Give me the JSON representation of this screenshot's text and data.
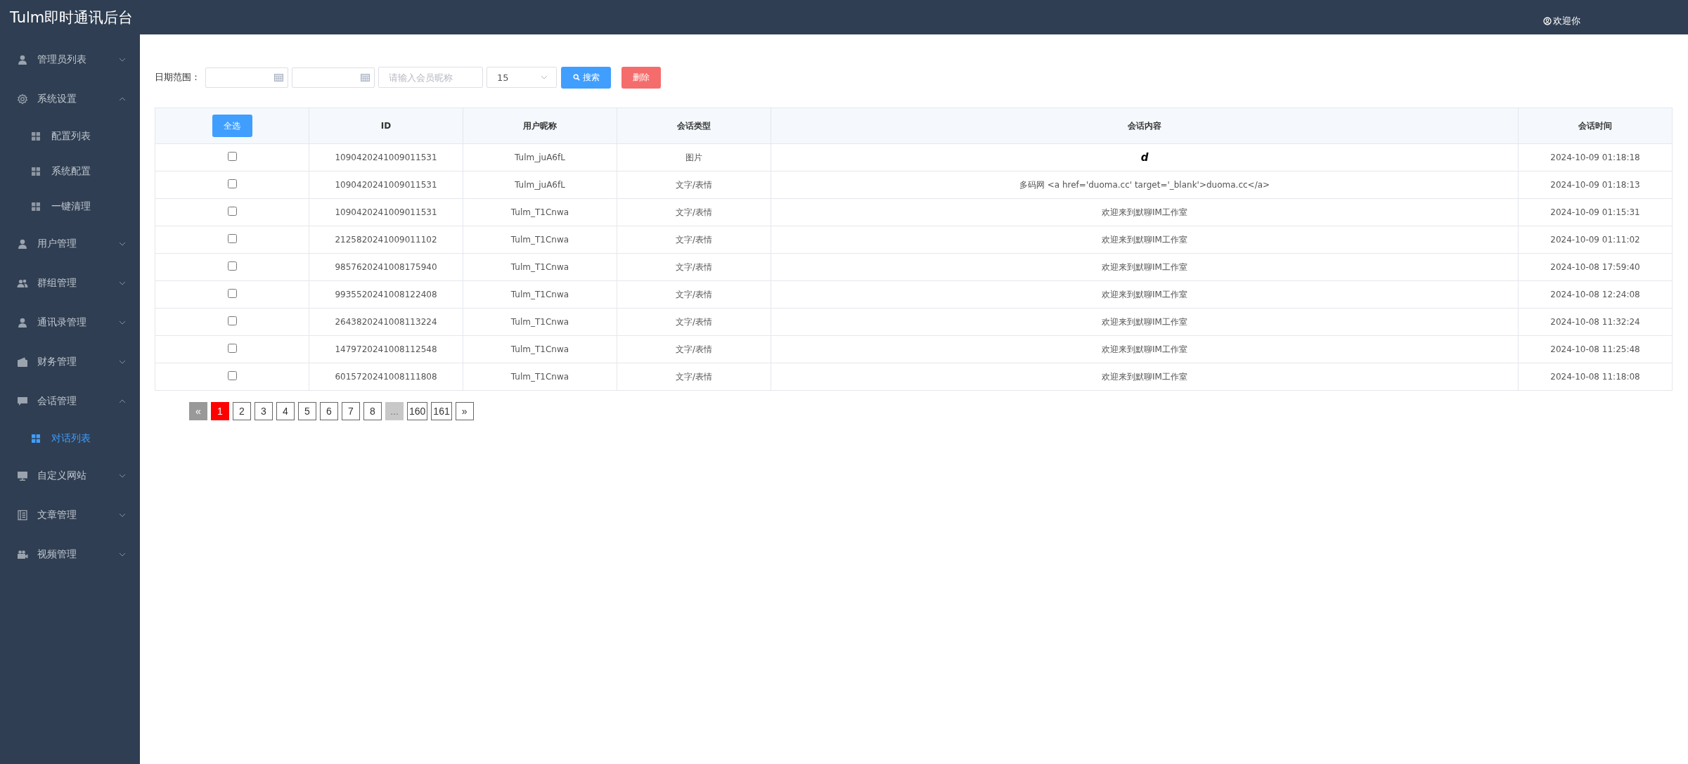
{
  "header": {
    "title": "Tulm即时通讯后台",
    "user": "欢迎你"
  },
  "sidebar": {
    "items": [
      {
        "label": "管理员列表",
        "kind": "user",
        "expanded": false
      },
      {
        "label": "系统设置",
        "kind": "gear",
        "expanded": true,
        "children": [
          {
            "label": "配置列表",
            "selected": false
          },
          {
            "label": "系统配置",
            "selected": false
          },
          {
            "label": "一键清理",
            "selected": false
          }
        ]
      },
      {
        "label": "用户管理",
        "kind": "user",
        "expanded": false
      },
      {
        "label": "群组管理",
        "kind": "group",
        "expanded": false
      },
      {
        "label": "通讯录管理",
        "kind": "user",
        "expanded": false
      },
      {
        "label": "财务管理",
        "kind": "wallet",
        "expanded": false
      },
      {
        "label": "会话管理",
        "kind": "chat",
        "expanded": true,
        "children": [
          {
            "label": "对话列表",
            "selected": true
          }
        ]
      },
      {
        "label": "自定义网站",
        "kind": "monitor",
        "expanded": false
      },
      {
        "label": "文章管理",
        "kind": "book",
        "expanded": false
      },
      {
        "label": "视频管理",
        "kind": "camera",
        "expanded": false
      }
    ]
  },
  "toolbar": {
    "date_label": "日期范围：",
    "nickname_placeholder": "请输入会员昵称",
    "page_size": "15",
    "search_button": "搜索",
    "delete_button": "删除"
  },
  "table": {
    "select_all": "全选",
    "columns": [
      "ID",
      "用户昵称",
      "会话类型",
      "会话内容",
      "会话时间"
    ],
    "rows": [
      {
        "checked": false,
        "id": "1090420241009011531",
        "nickname": "Tulm_juA6fL",
        "type": "图片",
        "content": "d",
        "kind": "image",
        "time": "2024-10-09 01:18:18"
      },
      {
        "checked": false,
        "id": "1090420241009011531",
        "nickname": "Tulm_juA6fL",
        "type": "文字/表情",
        "content": "多码网 <a href='duoma.cc' target='_blank'>duoma.cc</a>",
        "kind": "text",
        "time": "2024-10-09 01:18:13"
      },
      {
        "checked": false,
        "id": "1090420241009011531",
        "nickname": "Tulm_T1Cnwa",
        "type": "文字/表情",
        "content": "欢迎来到默聊IM工作室",
        "kind": "text",
        "time": "2024-10-09 01:15:31"
      },
      {
        "checked": false,
        "id": "2125820241009011102",
        "nickname": "Tulm_T1Cnwa",
        "type": "文字/表情",
        "content": "欢迎来到默聊IM工作室",
        "kind": "text",
        "time": "2024-10-09 01:11:02"
      },
      {
        "checked": false,
        "id": "9857620241008175940",
        "nickname": "Tulm_T1Cnwa",
        "type": "文字/表情",
        "content": "欢迎来到默聊IM工作室",
        "kind": "text",
        "time": "2024-10-08 17:59:40"
      },
      {
        "checked": false,
        "id": "9935520241008122408",
        "nickname": "Tulm_T1Cnwa",
        "type": "文字/表情",
        "content": "欢迎来到默聊IM工作室",
        "kind": "text",
        "time": "2024-10-08 12:24:08"
      },
      {
        "checked": false,
        "id": "2643820241008113224",
        "nickname": "Tulm_T1Cnwa",
        "type": "文字/表情",
        "content": "欢迎来到默聊IM工作室",
        "kind": "text",
        "time": "2024-10-08 11:32:24"
      },
      {
        "checked": false,
        "id": "1479720241008112548",
        "nickname": "Tulm_T1Cnwa",
        "type": "文字/表情",
        "content": "欢迎来到默聊IM工作室",
        "kind": "text",
        "time": "2024-10-08 11:25:48"
      },
      {
        "checked": false,
        "id": "6015720241008111808",
        "nickname": "Tulm_T1Cnwa",
        "type": "文字/表情",
        "content": "欢迎来到默聊IM工作室",
        "kind": "text",
        "time": "2024-10-08 11:18:08"
      }
    ]
  },
  "pagination": [
    {
      "label": "«",
      "kind": "prev",
      "selected": false,
      "disabled": true
    },
    {
      "label": "1",
      "kind": "page",
      "selected": true,
      "disabled": false
    },
    {
      "label": "2",
      "kind": "page",
      "selected": false,
      "disabled": false
    },
    {
      "label": "3",
      "kind": "page",
      "selected": false,
      "disabled": false
    },
    {
      "label": "4",
      "kind": "page",
      "selected": false,
      "disabled": false
    },
    {
      "label": "5",
      "kind": "page",
      "selected": false,
      "disabled": false
    },
    {
      "label": "6",
      "kind": "page",
      "selected": false,
      "disabled": false
    },
    {
      "label": "7",
      "kind": "page",
      "selected": false,
      "disabled": false
    },
    {
      "label": "8",
      "kind": "page",
      "selected": false,
      "disabled": false
    },
    {
      "label": "...",
      "kind": "ellipsis",
      "selected": false,
      "disabled": true
    },
    {
      "label": "160",
      "kind": "page",
      "selected": false,
      "disabled": false
    },
    {
      "label": "161",
      "kind": "page",
      "selected": false,
      "disabled": false
    },
    {
      "label": "»",
      "kind": "next",
      "selected": false,
      "disabled": false
    }
  ]
}
